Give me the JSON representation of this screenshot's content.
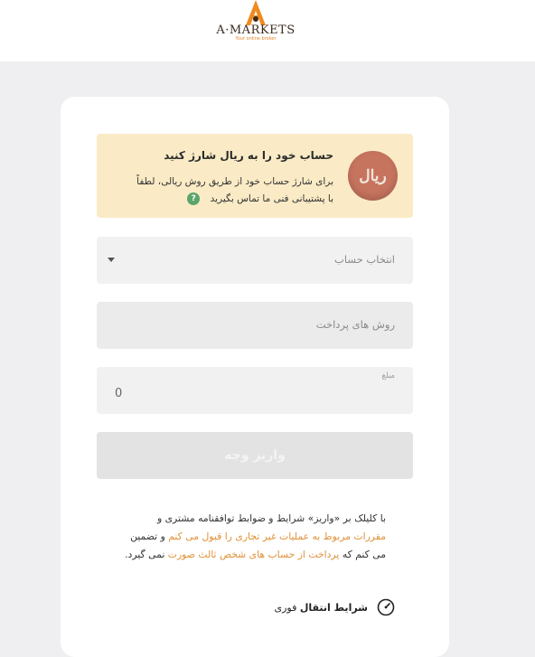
{
  "header": {
    "logo_name": "A·MARKETS",
    "logo_tagline": "Your online broker"
  },
  "notice": {
    "badge_text": "ریال",
    "title": "حساب خود را به ریال شارژ کنید",
    "text": "برای شارژ حساب خود از طریق روش ریالی، لطفاً با پشتیبانی فنی ما تماس بگیرید",
    "help_symbol": "?"
  },
  "form": {
    "account_placeholder": "انتخاب حساب",
    "method_placeholder": "روش های پرداخت",
    "amount_label": "مبلغ",
    "amount_value": "0",
    "submit_label": "واریز وجه"
  },
  "terms": {
    "part1": "با کلیلک بر «واریز» شرایط و ضوابط توافقنامه مشتری و ",
    "link1": "مقررات مربوط به عملیات غیر تجاری را قبول می کنم",
    "part2": " و تضمین می کنم که ",
    "link2": "پرداخت از حساب های شخص ثالث صورت",
    "part3": " نمی گیرد."
  },
  "instant_transfer": {
    "label_bold": "شرایط انتقال",
    "label_rest": " فوری"
  },
  "colors": {
    "accent": "#e0913a",
    "notice_bg": "#faebc6",
    "help_green": "#5aa56c"
  },
  "icons": [
    "logo-icon",
    "rial-icon",
    "help-icon",
    "caret-down-icon",
    "speedometer-icon"
  ]
}
